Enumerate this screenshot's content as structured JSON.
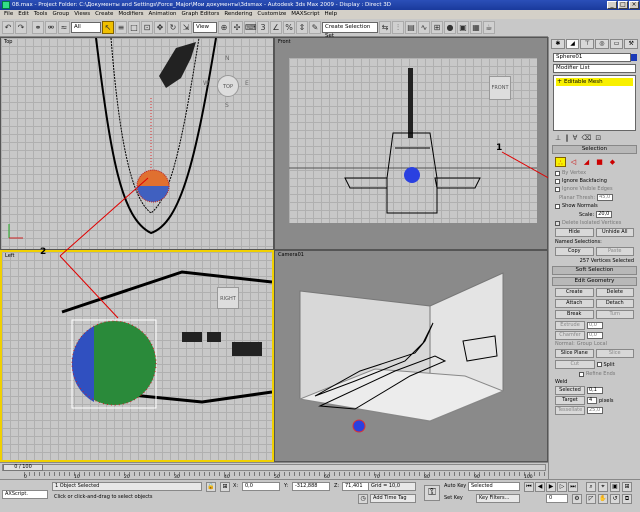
{
  "window": {
    "title": "08.max     - Project Folder: C:\\Документы and Settings\\Force_Major\\Мои документы\\3dsmax     - Autodesk 3ds Max  2009       - Display : Direct 3D",
    "minimize": "_",
    "maximize": "□",
    "close": "×"
  },
  "menu": [
    "File",
    "Edit",
    "Tools",
    "Group",
    "Views",
    "Create",
    "Modifiers",
    "Animation",
    "Graph Editors",
    "Rendering",
    "Customize",
    "MAXScript",
    "Help"
  ],
  "toolbar": {
    "filter_select": "All",
    "refcoord_select": "View",
    "named_selection_placeholder": "Create Selection Set"
  },
  "viewports": {
    "top_label": "Top",
    "top_cube": "TOP",
    "top_cube_n": "N",
    "top_cube_s": "S",
    "top_cube_e": "E",
    "top_cube_w": "W",
    "front_label": "Front",
    "front_cube": "FRONT",
    "left_label": "Left",
    "left_cube": "RIGHT",
    "camera_label": "Camera01"
  },
  "annotations": {
    "one": "1",
    "two": "2"
  },
  "command_panel": {
    "object_name": "Sphere01",
    "object_color": "#1a3ab8",
    "modifier_list": "Modifier List",
    "stack_item": "Editable Mesh",
    "selection_rollout": "Selection",
    "by_vertex": "By Vertex",
    "ignore_backfacing": "Ignore Backfacing",
    "ignore_visible_edges": "Ignore Visible Edges",
    "planar_thresh_label": "Planar Thresh:",
    "planar_thresh_value": "45,0",
    "show_normals": "Show Normals",
    "scale_label": "Scale:",
    "scale_value": "20,0",
    "delete_isolated": "Delete Isolated Vertices",
    "hide": "Hide",
    "unhide_all": "Unhide All",
    "named_selections": "Named Selections:",
    "copy": "Copy",
    "paste": "Paste",
    "selected_count": "257 Vertices Selected",
    "soft_selection_rollout": "Soft Selection",
    "edit_geometry_rollout": "Edit Geometry",
    "create": "Create",
    "delete": "Delete",
    "attach": "Attach",
    "detach": "Detach",
    "break": "Break",
    "turn": "Turn",
    "extrude": "Extrude",
    "extrude_value": "0,0",
    "chamfer": "Chamfer",
    "chamfer_value": "0,0",
    "normal_label": "Normal:",
    "group_label": "Group",
    "local_label": "Local",
    "slice_plane": "Slice Plane",
    "slice": "Slice",
    "cut": "Cut",
    "split": "Split",
    "refine_ends": "Refine Ends",
    "weld_label": "Weld",
    "selected_btn": "Selected",
    "selected_value": "0,1",
    "target_btn": "Target",
    "target_value": "4",
    "pixels": "pixels",
    "tessellate": "Tessellate",
    "tessellate_value": "25,0"
  },
  "timeline": {
    "frame": "0 / 100",
    "ticks": [
      "0",
      "10",
      "20",
      "30",
      "40",
      "50",
      "60",
      "70",
      "80",
      "90",
      "100"
    ]
  },
  "status": {
    "maxscript": "AXScript.",
    "objects_selected": "1 Object Selected",
    "prompt": "Click or click-and-drag to select objects",
    "x_label": "X:",
    "x_value": "0,0",
    "y_label": "Y:",
    "y_value": "-312,888",
    "z_label": "Z:",
    "z_value": "71,401",
    "grid": "Grid = 10,0",
    "add_time_tag": "Add Time Tag",
    "auto_key": "Auto Key",
    "set_key": "Set Key",
    "key_select": "Selected",
    "key_filters": "Key Filters...",
    "frame_field": "0"
  }
}
